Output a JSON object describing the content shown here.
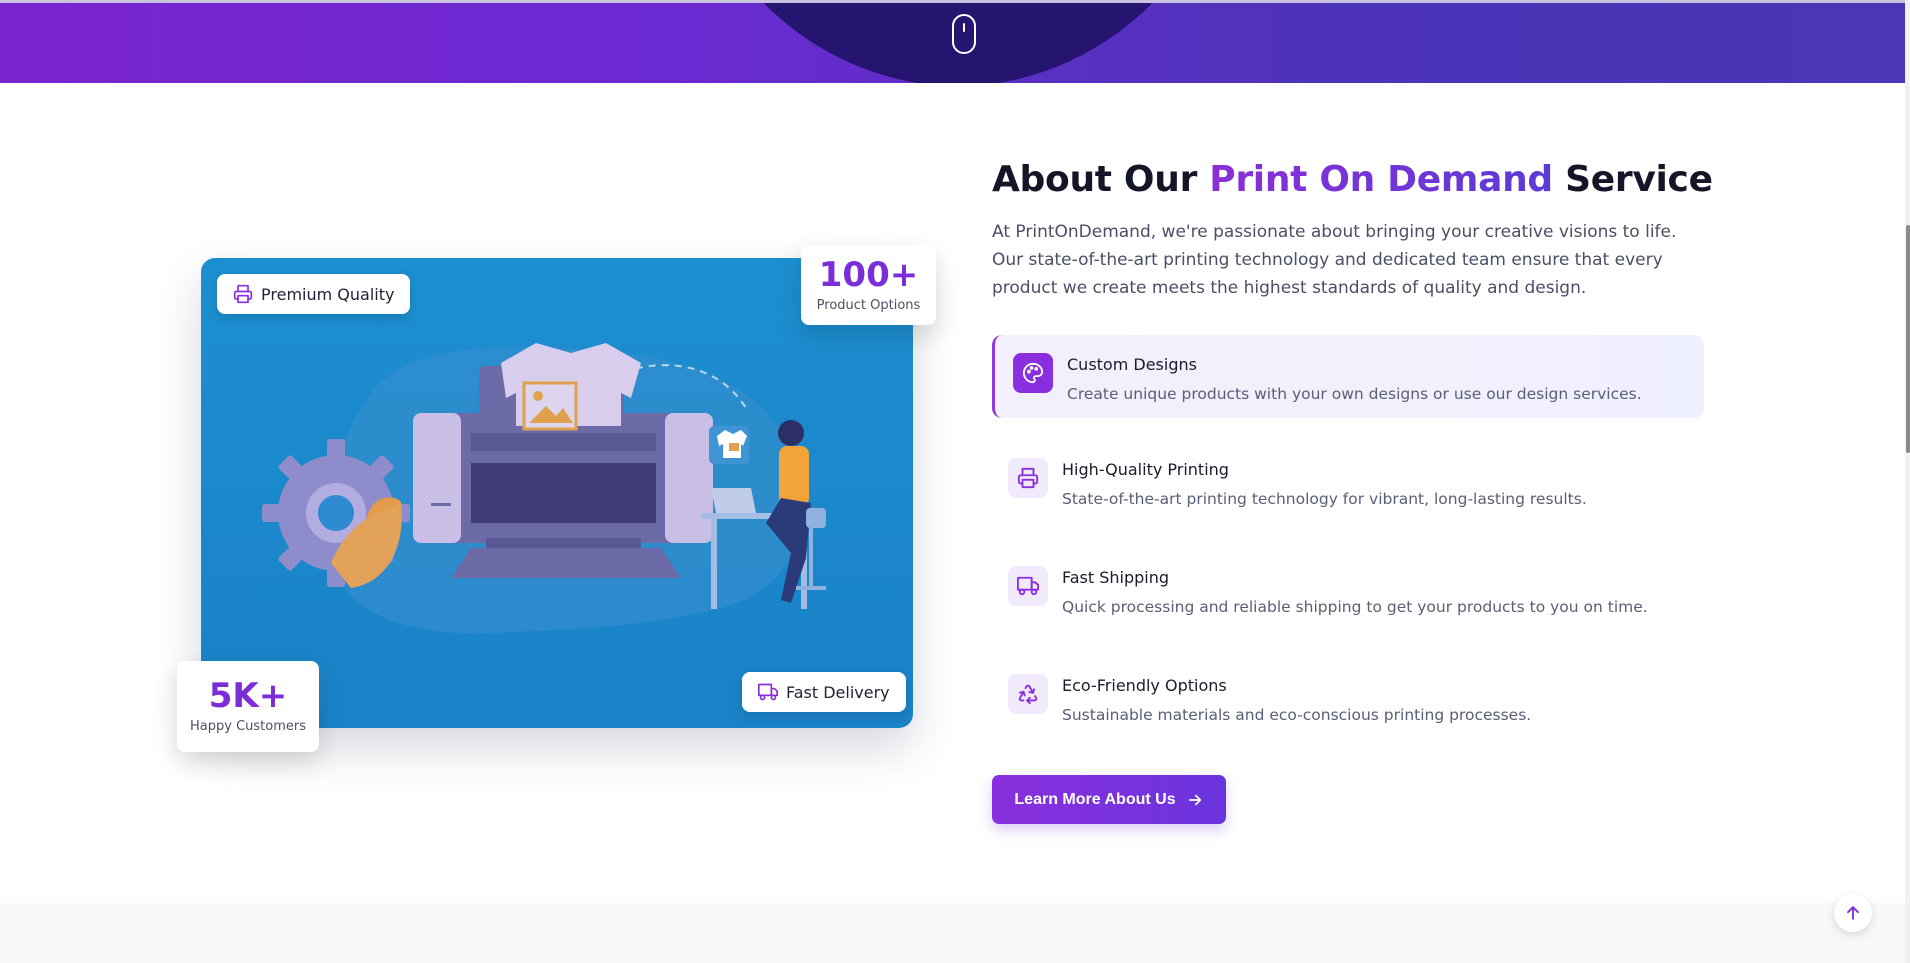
{
  "hero": {
    "scroll_icon": "mouse-scroll-icon"
  },
  "visual": {
    "badge_quality": {
      "label": "Premium Quality",
      "icon": "printer-icon"
    },
    "badge_delivery": {
      "label": "Fast Delivery",
      "icon": "truck-icon"
    },
    "stat_products": {
      "value": "100+",
      "label": "Product Options"
    },
    "stat_customers": {
      "value": "5K+",
      "label": "Happy Customers"
    }
  },
  "about": {
    "title_prefix": "About Our ",
    "title_accent": "Print On Demand",
    "title_suffix": " Service",
    "intro": "At PrintOnDemand, we're passionate about bringing your creative visions to life. Our state-of-the-art printing technology and dedicated team ensure that every product we create meets the highest standards of quality and design.",
    "features": [
      {
        "title": "Custom Designs",
        "desc": "Create unique products with your own designs or use our design services.",
        "icon": "palette-icon"
      },
      {
        "title": "High-Quality Printing",
        "desc": "State-of-the-art printing technology for vibrant, long-lasting results.",
        "icon": "printer-icon"
      },
      {
        "title": "Fast Shipping",
        "desc": "Quick processing and reliable shipping to get your products to you on time.",
        "icon": "truck-icon"
      },
      {
        "title": "Eco-Friendly Options",
        "desc": "Sustainable materials and eco-conscious printing processes.",
        "icon": "recycle-icon"
      }
    ],
    "cta_label": "Learn More About Us"
  },
  "colors": {
    "accent": "#8a2fdd",
    "accent_secondary": "#5c3ad6",
    "card_blue": "#1c8fd0",
    "hero_dark": "#251470"
  }
}
